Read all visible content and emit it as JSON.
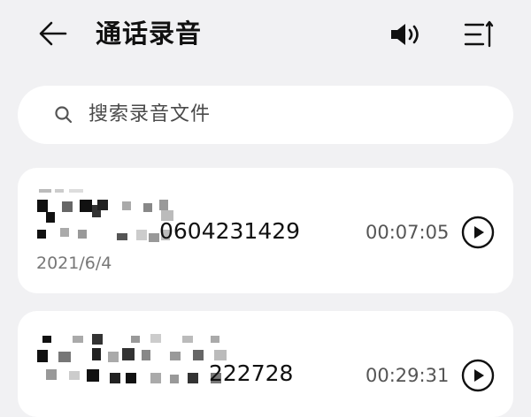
{
  "header": {
    "title": "通话录音",
    "back_icon": "arrow-left-icon",
    "speaker_icon": "speaker-icon",
    "sort_icon": "sort-icon"
  },
  "search": {
    "placeholder": "搜索录音文件",
    "icon": "search-icon"
  },
  "recordings": [
    {
      "number_suffix": "0604231429",
      "duration": "00:07:05",
      "date": "2021/6/4",
      "play_icon": "play-icon"
    },
    {
      "number_suffix": "222728",
      "duration": "00:29:31",
      "play_icon": "play-icon"
    }
  ],
  "colors": {
    "background": "#f1f1f3",
    "card": "#ffffff",
    "text_primary": "#111111",
    "text_secondary": "#777777"
  }
}
